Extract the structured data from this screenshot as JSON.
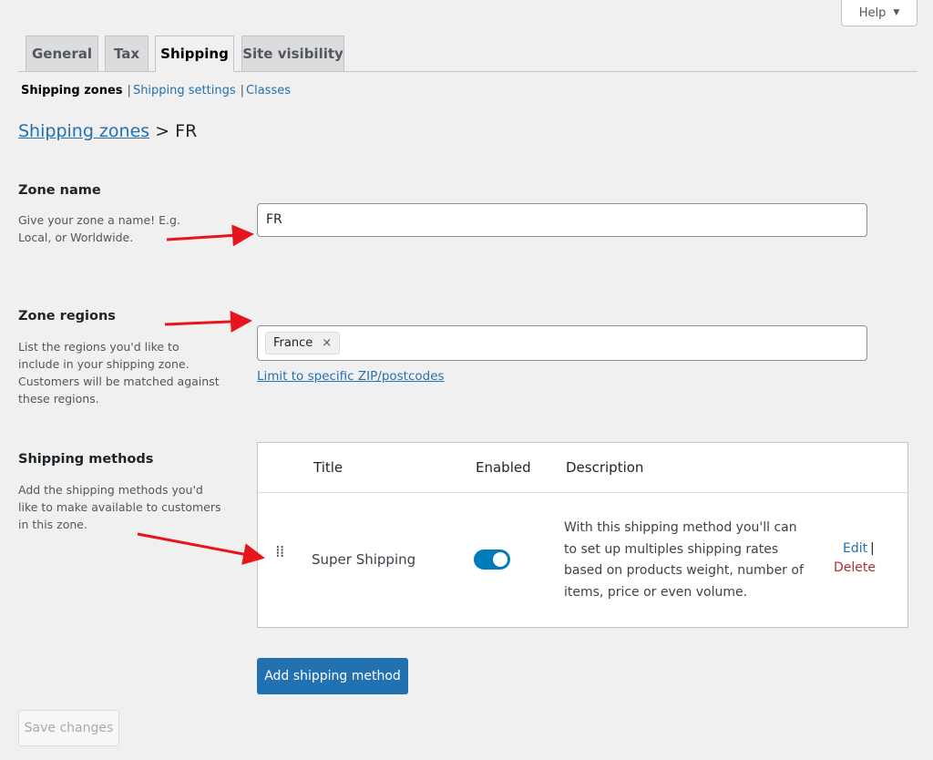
{
  "help": {
    "label": "Help"
  },
  "tabs": [
    {
      "label": "General"
    },
    {
      "label": "Tax"
    },
    {
      "label": "Shipping",
      "active": true
    },
    {
      "label": "Site visibility"
    }
  ],
  "subnav": {
    "current": "Shipping zones",
    "items": [
      {
        "label": "Shipping settings"
      },
      {
        "label": "Classes"
      }
    ],
    "separator": "|"
  },
  "breadcrumb": {
    "link": "Shipping zones",
    "separator": ">",
    "current": "FR"
  },
  "zone_name": {
    "heading": "Zone name",
    "description": "Give your zone a name! E.g. Local, or Worldwide.",
    "value": "FR"
  },
  "zone_regions": {
    "heading": "Zone regions",
    "description": "List the regions you'd like to include in your shipping zone. Customers will be matched against these regions.",
    "chips": [
      {
        "label": "France",
        "remove": "×"
      }
    ],
    "link": "Limit to specific ZIP/postcodes"
  },
  "shipping_methods": {
    "heading": "Shipping methods",
    "description": "Add the shipping methods you'd like to make available to customers in this zone.",
    "columns": {
      "title": "Title",
      "enabled": "Enabled",
      "description": "Description"
    },
    "rows": [
      {
        "title": "Super Shipping",
        "enabled": true,
        "description": "With this shipping method you'll can to set up multiples shipping rates based on products weight, number of items, price or even volume.",
        "edit": "Edit",
        "sep": "|",
        "delete": "Delete"
      }
    ]
  },
  "add_button": "Add shipping method",
  "save_button": "Save changes",
  "colors": {
    "accent": "#2271b1",
    "toggle": "#007cba",
    "delete": "#b32d2e",
    "annotation_arrow": "#e8141c"
  }
}
